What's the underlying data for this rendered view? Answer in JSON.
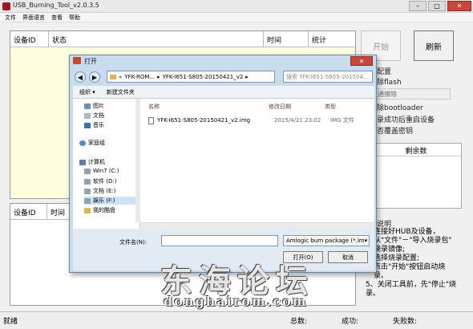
{
  "app": {
    "title": "USB_Burning_Tool_v2.0.3.5",
    "menu": [
      "文件",
      "界面语言",
      "查看",
      "帮助"
    ],
    "window_controls": {
      "minimize": "–",
      "maximize": "□",
      "close": "✕"
    }
  },
  "table1": {
    "columns": [
      "设备ID",
      "状态",
      "时间",
      "统计"
    ]
  },
  "table2": {
    "columns": [
      "设备ID",
      "时间"
    ]
  },
  "buttons": {
    "start": "开始",
    "refresh": "刷新"
  },
  "right_panel": {
    "config_title": "配置",
    "erase_flash": "除flash",
    "erase_mode": "通擦除",
    "erase_bootloader": "除bootloader",
    "reboot_after": "录成功后重启设备",
    "overwrite_key": "否覆盖密钥",
    "remaining_header": "剩余数",
    "instructions_title": "说明",
    "instructions": [
      "连接好HUB及设备，",
      "从\"文件\"－\"导入烧录包\"",
      "烧录镜像;",
      "选择烧录配置;",
      "点击\"开始\"按钮启动烧",
      "录。",
      "5、关闭工具前，先\"停止\"烧",
      "录。"
    ]
  },
  "statusbar": {
    "ready": "就绪",
    "total": "总数:",
    "success": "成功:",
    "fail": "失败数:"
  },
  "dialog": {
    "title": "打开",
    "close": "✕",
    "breadcrumb": [
      "«",
      "YFK-ROM...",
      "▸",
      "YFK-I651-S805-20150421_v2",
      "▸"
    ],
    "search_placeholder": "搜索 YFK-I651-S805-201504...",
    "toolbar": {
      "organize": "组织 ▾",
      "new_folder": "新建文件夹"
    },
    "nav_items": [
      "图片",
      "文档",
      "音乐",
      "家庭组",
      "计算机",
      "Win7 (C:)",
      "软件 (D:)",
      "文档 (E:)",
      "娱乐 (F:)",
      "我的酷盘"
    ],
    "columns": {
      "name": "名称",
      "date": "修改日期",
      "type": "类型"
    },
    "file": {
      "name": "YFK-I651-S805-20150421_v2.img",
      "date": "2015/4/21 23:02",
      "type": "IMG 文件"
    },
    "filename_label": "文件名(N):",
    "filetype": "Amlogic burn package (*.im▾",
    "open": "打开(O)",
    "cancel": "取消"
  },
  "watermark": {
    "cn": "东海论坛",
    "en": "donghairom.com"
  }
}
